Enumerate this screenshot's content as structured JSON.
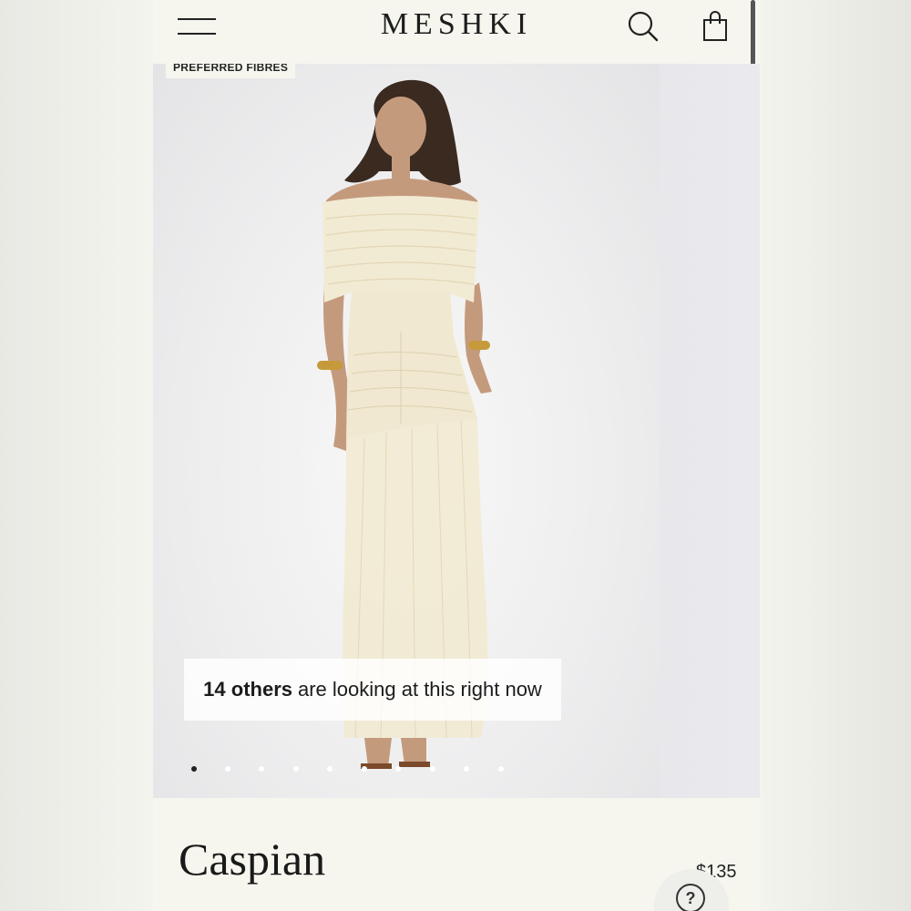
{
  "header": {
    "brand": "MESHKI",
    "menu_icon": "hamburger-menu-icon",
    "search_icon": "search-icon",
    "bag_icon": "shopping-bag-icon"
  },
  "gallery": {
    "badge": "PREFERRED FIBRES",
    "social_proof_count": "14 others",
    "social_proof_text": "are looking at this right now",
    "slide_count": 10,
    "active_slide": 1
  },
  "product": {
    "name": "Caspian",
    "price": "$135"
  },
  "help": {
    "icon": "help-question-icon",
    "symbol": "?"
  },
  "colors": {
    "background": "#f5f5ee",
    "text": "#1d1d1d",
    "dress": "#f0e8cf"
  }
}
